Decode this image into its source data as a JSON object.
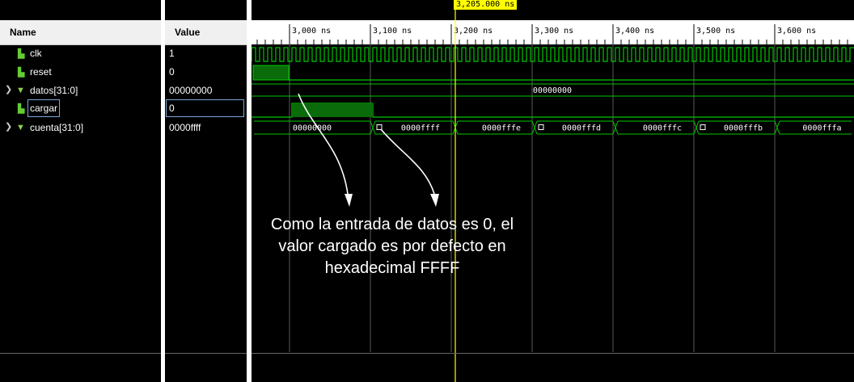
{
  "headers": {
    "name": "Name",
    "value": "Value"
  },
  "signals": [
    {
      "name": "clk",
      "value": "1",
      "expandable": false,
      "icon": "bit-signal-icon"
    },
    {
      "name": "reset",
      "value": "0",
      "expandable": false,
      "icon": "bit-signal-icon"
    },
    {
      "name": "datos[31:0]",
      "value": "00000000",
      "expandable": true,
      "icon": "bus-signal-icon"
    },
    {
      "name": "cargar",
      "value": "0",
      "expandable": false,
      "icon": "bit-signal-icon",
      "selected": true
    },
    {
      "name": "cuenta[31:0]",
      "value": "0000ffff",
      "expandable": true,
      "icon": "bus-signal-icon"
    }
  ],
  "timeline": {
    "ticks": [
      "3,000 ns",
      "3,100 ns",
      "3,200 ns",
      "3,300 ns",
      "3,400 ns",
      "3,500 ns",
      "3,600 ns"
    ],
    "cursor": "3,205.000 ns",
    "datos_value": "00000000",
    "cuenta_values": [
      "00000000",
      "0000ffff",
      "0000fffe",
      "0000fffd",
      "0000fffc",
      "0000fffb",
      "0000fffa"
    ]
  },
  "annotation": {
    "line1": "Como la entrada de datos es 0, el",
    "line2": "valor cargado es por defecto en",
    "line3": "hexadecimal FFFF"
  },
  "colors": {
    "wave": "#00c800",
    "cursor": "#ffff00",
    "grid": "#5a5a5a"
  }
}
